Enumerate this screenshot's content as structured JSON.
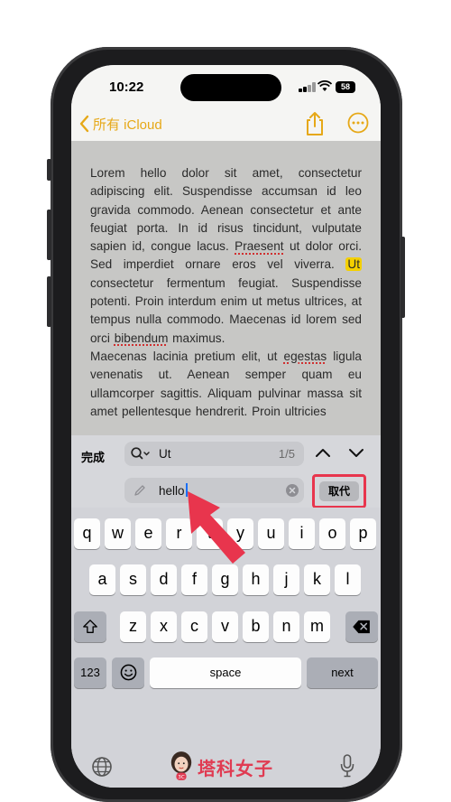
{
  "status_bar": {
    "time": "10:22",
    "battery": "58"
  },
  "nav": {
    "back_label": "所有 iCloud"
  },
  "note": {
    "segments": [
      {
        "t": "Lorem hello dolor sit amet, consectetur adipiscing elit. Suspendisse accumsan id leo gravida commodo. Aenean consectetur et ante feugiat porta. In id risus tincidunt, vulputate sapien id, congue lacus. "
      },
      {
        "t": "Praesent",
        "s": "spell"
      },
      {
        "t": " ut dolor orci. Sed imperdiet ornare eros vel viverra. "
      },
      {
        "t": "Ut",
        "s": "hl"
      },
      {
        "t": " consectetur fermentum feugiat. Suspendisse potenti. Proin interdum enim ut metus ultrices, at tempus nulla commodo. Maecenas id lorem sed orci "
      },
      {
        "t": "bibendum",
        "s": "spell"
      },
      {
        "t": " maximus."
      },
      {
        "t": "\n"
      },
      {
        "t": "Maecenas lacinia pretium elit, ut "
      },
      {
        "t": "egestas",
        "s": "spell"
      },
      {
        "t": " ligula venenatis ut. Aenean semper quam eu ullamcorper sagittis. Aliquam pulvinar massa sit amet pellentesque hendrerit. Proin ultricies"
      }
    ]
  },
  "find": {
    "done_label": "完成",
    "search_value": "Ut",
    "match_count": "1/5",
    "replace_value": "hello",
    "replace_label": "取代"
  },
  "keyboard": {
    "row1": [
      "q",
      "w",
      "e",
      "r",
      "t",
      "y",
      "u",
      "i",
      "o",
      "p"
    ],
    "row2": [
      "a",
      "s",
      "d",
      "f",
      "g",
      "h",
      "j",
      "k",
      "l"
    ],
    "row3": [
      "z",
      "x",
      "c",
      "v",
      "b",
      "n",
      "m"
    ],
    "num_label": "123",
    "space_label": "space",
    "next_label": "next"
  },
  "brand": {
    "text": "塔科女子",
    "badge": "3C"
  },
  "colors": {
    "accent": "#e6a817",
    "highlight": "#f4d000",
    "annotation": "#e8354d"
  },
  "icons": [
    "back-chevron-icon",
    "share-icon",
    "more-icon",
    "search-icon",
    "pencil-icon",
    "clear-icon",
    "chevron-up-icon",
    "chevron-down-icon",
    "shift-icon",
    "backspace-icon",
    "emoji-icon",
    "globe-icon",
    "microphone-icon",
    "red-arrow-annotation"
  ]
}
